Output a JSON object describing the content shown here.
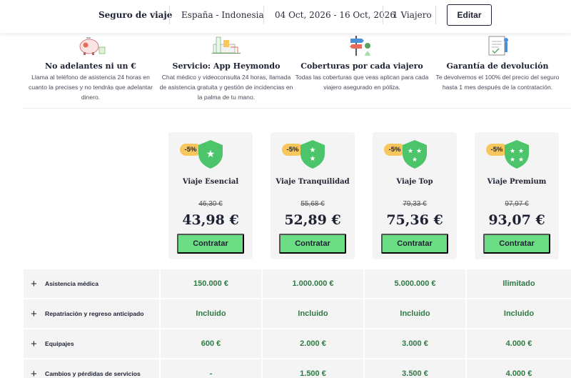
{
  "header": {
    "title": "Seguro de viaje",
    "route": "España - Indonesia",
    "dates": "04 Oct, 2026 - 16 Oct, 2026",
    "travelers": "1 Viajero",
    "edit_label": "Editar"
  },
  "features": [
    {
      "icon": "piggy-bank-icon",
      "title": "No adelantes ni un €",
      "text": "Llama al teléfono de asistencia 24 horas en cuanto la precises y no tendrás que adelantar dinero."
    },
    {
      "icon": "mobile-app-icon",
      "title": "Servicio: App Heymondo",
      "text": "Chat médico y videoconsulta 24 horas, llamada de asistencia gratuita y gestión de incidencias en la palma de tu mano."
    },
    {
      "icon": "traveler-signpost-icon",
      "title": "Coberturas por cada viajero",
      "text": "Todas las coberturas que veas aplican para cada viajero asegurado en póliza."
    },
    {
      "icon": "document-check-icon",
      "title": "Garantía de devolución",
      "text": "Te devolvemos el 100% del precio del seguro hasta 1 mes después de la contratación."
    }
  ],
  "plans": [
    {
      "badge": "-5%",
      "stars": 1,
      "name": "Viaje Esencial",
      "old_price": "46,30 €",
      "price": "43,98 €",
      "cta": "Contratar"
    },
    {
      "badge": "-5%",
      "stars": 2,
      "name": "Viaje Tranquilidad",
      "old_price": "55,68 €",
      "price": "52,89 €",
      "cta": "Contratar"
    },
    {
      "badge": "-5%",
      "stars": 3,
      "name": "Viaje Top",
      "old_price": "79,33 €",
      "price": "75,36 €",
      "cta": "Contratar"
    },
    {
      "badge": "-5%",
      "stars": 4,
      "name": "Viaje Premium",
      "old_price": "97,97 €",
      "price": "93,07 €",
      "cta": "Contratar"
    }
  ],
  "coverages": [
    {
      "label": "Asistencia médica",
      "values": [
        "150.000 €",
        "1.000.000 €",
        "5.000.000 €",
        "Ilimitado"
      ]
    },
    {
      "label": "Repatriación y regreso anticipado",
      "values": [
        "Incluido",
        "Incluido",
        "Incluido",
        "Incluido"
      ]
    },
    {
      "label": "Equipajes",
      "values": [
        "600 €",
        "2.000 €",
        "3.000 €",
        "4.000 €"
      ]
    },
    {
      "label": "Cambios y pérdidas de servicios",
      "values": [
        "-",
        "1.500 €",
        "3.500 €",
        "4.000 €"
      ]
    }
  ],
  "colors": {
    "accent_green": "#6bdd84",
    "value_green": "#2f7a44",
    "badge_yellow": "#f7c65c",
    "shield_green": "#4cc46a",
    "text_dark": "#1f2233"
  },
  "icons": {
    "expand": "+",
    "star": "★"
  }
}
